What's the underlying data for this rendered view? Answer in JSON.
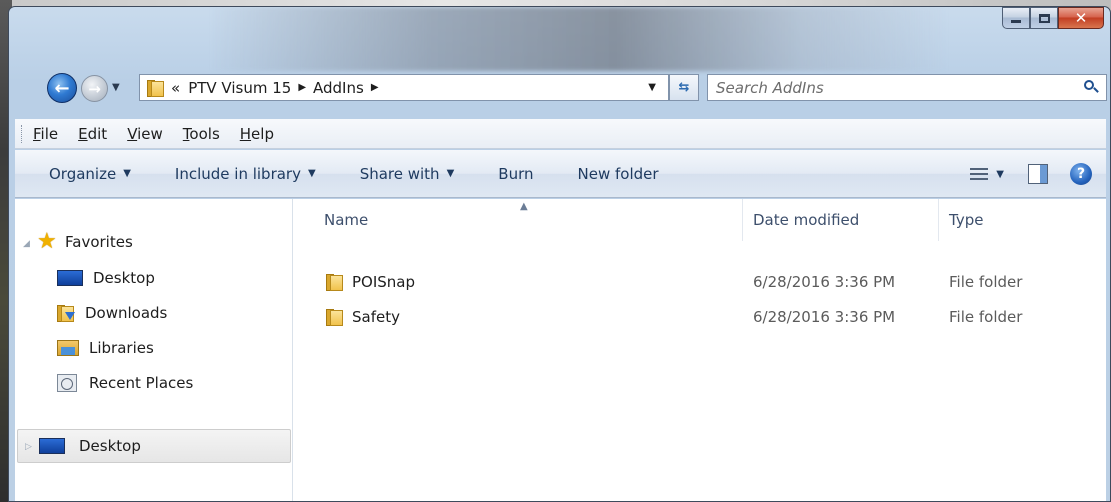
{
  "window": {
    "caption_buttons": {
      "minimize": "minimize-icon",
      "maximize": "maximize-icon",
      "close": "close-icon"
    }
  },
  "nav": {
    "breadcrumb_prefix": "«",
    "breadcrumbs": [
      "PTV Visum 15",
      "AddIns"
    ],
    "search_placeholder": "Search AddIns"
  },
  "menu": {
    "items": [
      {
        "label": "File",
        "accel": "F"
      },
      {
        "label": "Edit",
        "accel": "E"
      },
      {
        "label": "View",
        "accel": "V"
      },
      {
        "label": "Tools",
        "accel": "T"
      },
      {
        "label": "Help",
        "accel": "H"
      }
    ]
  },
  "toolbar": {
    "organize": "Organize",
    "include_in_library": "Include in library",
    "share_with": "Share with",
    "burn": "Burn",
    "new_folder": "New folder"
  },
  "sidebar": {
    "favorites_label": "Favorites",
    "items": [
      {
        "label": "Desktop",
        "icon": "desktop-icon"
      },
      {
        "label": "Downloads",
        "icon": "downloads-folder-icon"
      },
      {
        "label": "Libraries",
        "icon": "libraries-icon"
      },
      {
        "label": "Recent Places",
        "icon": "recent-places-icon"
      }
    ],
    "desktop_root": "Desktop"
  },
  "file_list": {
    "columns": {
      "name": "Name",
      "date_modified": "Date modified",
      "type": "Type"
    },
    "sort_column": "Name",
    "rows": [
      {
        "name": "POISnap",
        "date_modified": "6/28/2016 3:36 PM",
        "type": "File folder"
      },
      {
        "name": "Safety",
        "date_modified": "6/28/2016 3:36 PM",
        "type": "File folder"
      }
    ]
  },
  "colors": {
    "window_frame": "#bcd0e5",
    "close_button": "#c23e23",
    "command_text": "#1e3a5f"
  }
}
